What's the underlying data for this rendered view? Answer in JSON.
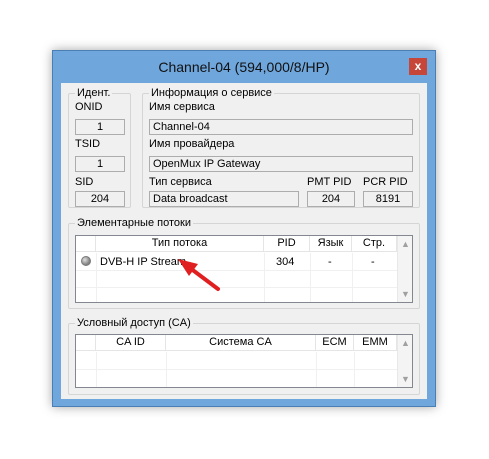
{
  "window": {
    "title": "Channel-04 (594,000/8/HP)",
    "close_glyph": "x"
  },
  "ident": {
    "legend": "Идент.",
    "onid_label": "ONID",
    "onid_value": "1",
    "tsid_label": "TSID",
    "tsid_value": "1",
    "sid_label": "SID",
    "sid_value": "204"
  },
  "service_info": {
    "legend": "Информация о сервисе",
    "service_name_label": "Имя сервиса",
    "service_name_value": "Channel-04",
    "provider_label": "Имя провайдера",
    "provider_value": "OpenMux IP Gateway",
    "service_type_label": "Тип сервиса",
    "service_type_value": "Data broadcast",
    "pmt_pid_label": "PMT PID",
    "pmt_pid_value": "204",
    "pcr_pid_label": "PCR PID",
    "pcr_pid_value": "8191"
  },
  "streams": {
    "legend": "Элементарные потоки",
    "columns": [
      "",
      "Тип потока",
      "PID",
      "Язык",
      "Стр."
    ],
    "rows": [
      {
        "type": "DVB-H IP Stream",
        "pid": "304",
        "lang": "-",
        "page": "-"
      }
    ]
  },
  "ca": {
    "legend": "Условный доступ (CA)",
    "columns": [
      "",
      "CA ID",
      "Система CA",
      "ECM",
      "EMM"
    ]
  },
  "colors": {
    "frame": "#6fa6dc",
    "close_button": "#c7463a",
    "annotation_arrow": "#e02020"
  },
  "icons": {
    "close": "close-icon",
    "stream_status": "gray-dot-icon",
    "scroll_up": "chevron-up-icon",
    "scroll_down": "chevron-down-icon",
    "annotation": "red-arrow-icon"
  }
}
